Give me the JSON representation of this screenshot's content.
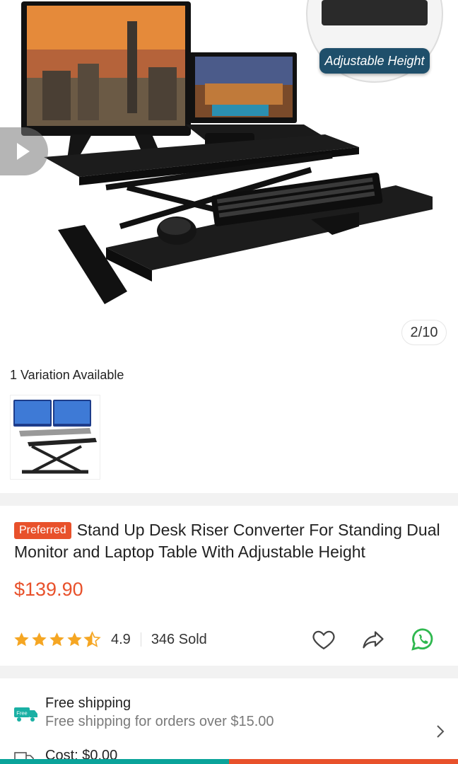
{
  "gallery": {
    "counter": "2/10",
    "badge_text": "Adjustable Height",
    "colors": {
      "desk": "#1b1b1b",
      "badge_bg": "#1f4f6b"
    }
  },
  "variation": {
    "label": "1 Variation Available"
  },
  "product": {
    "badge": "Preferred",
    "title": "Stand Up Desk Riser Converter For Standing Dual Monitor and Laptop Table With Adjustable Height",
    "price": "$139.90",
    "rating": "4.9",
    "rating_stars": 4.5,
    "sold": "346 Sold",
    "accent_color": "#e8512b"
  },
  "actions": {
    "icons": [
      "heart-icon",
      "share-icon",
      "whatsapp-icon"
    ]
  },
  "shipping": {
    "icon_text": "Free",
    "title": "Free shipping",
    "subtitle": "Free shipping for orders over $15.00",
    "cost": "Cost: $0.00"
  }
}
